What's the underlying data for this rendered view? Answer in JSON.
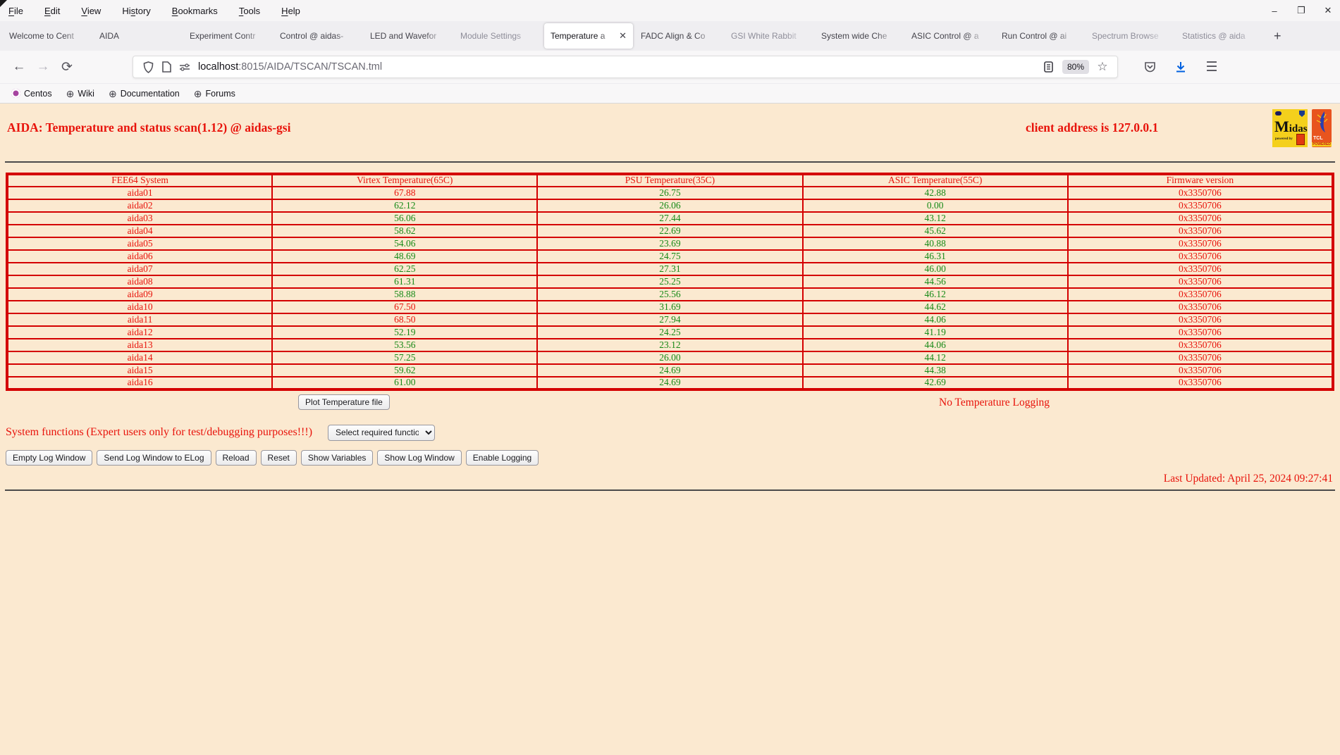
{
  "colors": {
    "page_background": "#fbe9d0",
    "accent_red": "#e8130b",
    "value_green": "#168a16",
    "table_border_red": "#d40000",
    "download_blue": "#0060df"
  },
  "browser": {
    "menu_items": [
      {
        "label": "File",
        "accel": 0
      },
      {
        "label": "Edit",
        "accel": 0
      },
      {
        "label": "View",
        "accel": 0
      },
      {
        "label": "History",
        "accel": 2
      },
      {
        "label": "Bookmarks",
        "accel": 0
      },
      {
        "label": "Tools",
        "accel": 0
      },
      {
        "label": "Help",
        "accel": 0
      }
    ],
    "window_controls": [
      {
        "name": "minimize",
        "glyph": "–"
      },
      {
        "name": "maximize",
        "glyph": "❐"
      },
      {
        "name": "close",
        "glyph": "✕"
      }
    ],
    "tabs": [
      {
        "label": "Welcome to Cent",
        "active": false,
        "dim": false
      },
      {
        "label": "AIDA",
        "active": false,
        "dim": false
      },
      {
        "label": "Experiment Contr",
        "active": false,
        "dim": false
      },
      {
        "label": "Control @ aidas-",
        "active": false,
        "dim": false
      },
      {
        "label": "LED and Wavefor",
        "active": false,
        "dim": false
      },
      {
        "label": "Module Settings",
        "active": false,
        "dim": true
      },
      {
        "label": "Temperature a",
        "active": true,
        "dim": false
      },
      {
        "label": "FADC Align & Co",
        "active": false,
        "dim": false
      },
      {
        "label": "GSI White Rabbit",
        "active": false,
        "dim": true
      },
      {
        "label": "System wide Che",
        "active": false,
        "dim": false
      },
      {
        "label": "ASIC Control @ a",
        "active": false,
        "dim": false
      },
      {
        "label": "Run Control @ ai",
        "active": false,
        "dim": false
      },
      {
        "label": "Spectrum Browse",
        "active": false,
        "dim": true
      },
      {
        "label": "Statistics @ aida",
        "active": false,
        "dim": true
      }
    ],
    "tab_close_glyph": "✕",
    "new_tab_button": "+",
    "url": {
      "host": "localhost",
      "rest": ":8015/AIDA/TSCAN/TSCAN.tml"
    },
    "zoom_level": "80%",
    "bookmarks": [
      {
        "label": "Centos",
        "icon": "centos"
      },
      {
        "label": "Wiki",
        "icon": "globe"
      },
      {
        "label": "Documentation",
        "icon": "globe"
      },
      {
        "label": "Forums",
        "icon": "globe"
      }
    ],
    "globe_glyph": "⊕",
    "hamburger_glyph": "☰",
    "star_glyph": "☆",
    "back_glyph": "←",
    "forward_glyph": "→",
    "reload_glyph": "⟳"
  },
  "page": {
    "title": "AIDA: Temperature and status scan(1.12) @ aidas-gsi",
    "client_address": "client address is 127.0.0.1",
    "logos": {
      "midas_big_letter": "M",
      "midas_rest": "idas",
      "midas_powered_by": "powered by",
      "tcl_text": "TCL",
      "tcl_banner": "POWERED"
    },
    "table": {
      "headers": [
        "FEE64 System",
        "Virtex Temperature(65C)",
        "PSU Temperature(35C)",
        "ASIC Temperature(55C)",
        "Firmware version"
      ],
      "rows": [
        {
          "system": "aida01",
          "virtex": "67.88",
          "virtex_alarm": true,
          "psu": "26.75",
          "asic": "42.88",
          "firmware": "0x3350706"
        },
        {
          "system": "aida02",
          "virtex": "62.12",
          "virtex_alarm": false,
          "psu": "26.06",
          "asic": "0.00",
          "firmware": "0x3350706"
        },
        {
          "system": "aida03",
          "virtex": "56.06",
          "virtex_alarm": false,
          "psu": "27.44",
          "asic": "43.12",
          "firmware": "0x3350706"
        },
        {
          "system": "aida04",
          "virtex": "58.62",
          "virtex_alarm": false,
          "psu": "22.69",
          "asic": "45.62",
          "firmware": "0x3350706"
        },
        {
          "system": "aida05",
          "virtex": "54.06",
          "virtex_alarm": false,
          "psu": "23.69",
          "asic": "40.88",
          "firmware": "0x3350706"
        },
        {
          "system": "aida06",
          "virtex": "48.69",
          "virtex_alarm": false,
          "psu": "24.75",
          "asic": "46.31",
          "firmware": "0x3350706"
        },
        {
          "system": "aida07",
          "virtex": "62.25",
          "virtex_alarm": false,
          "psu": "27.31",
          "asic": "46.00",
          "firmware": "0x3350706"
        },
        {
          "system": "aida08",
          "virtex": "61.31",
          "virtex_alarm": false,
          "psu": "25.25",
          "asic": "44.56",
          "firmware": "0x3350706"
        },
        {
          "system": "aida09",
          "virtex": "58.88",
          "virtex_alarm": false,
          "psu": "25.56",
          "asic": "46.12",
          "firmware": "0x3350706"
        },
        {
          "system": "aida10",
          "virtex": "67.50",
          "virtex_alarm": true,
          "psu": "31.69",
          "asic": "44.62",
          "firmware": "0x3350706"
        },
        {
          "system": "aida11",
          "virtex": "68.50",
          "virtex_alarm": true,
          "psu": "27.94",
          "asic": "44.06",
          "firmware": "0x3350706"
        },
        {
          "system": "aida12",
          "virtex": "52.19",
          "virtex_alarm": false,
          "psu": "24.25",
          "asic": "41.19",
          "firmware": "0x3350706"
        },
        {
          "system": "aida13",
          "virtex": "53.56",
          "virtex_alarm": false,
          "psu": "23.12",
          "asic": "44.06",
          "firmware": "0x3350706"
        },
        {
          "system": "aida14",
          "virtex": "57.25",
          "virtex_alarm": false,
          "psu": "26.00",
          "asic": "44.12",
          "firmware": "0x3350706"
        },
        {
          "system": "aida15",
          "virtex": "59.62",
          "virtex_alarm": false,
          "psu": "24.69",
          "asic": "44.38",
          "firmware": "0x3350706"
        },
        {
          "system": "aida16",
          "virtex": "61.00",
          "virtex_alarm": false,
          "psu": "24.69",
          "asic": "42.69",
          "firmware": "0x3350706"
        }
      ]
    },
    "plot_button": "Plot Temperature file",
    "logging_status": "No Temperature Logging",
    "system_functions_label": "System functions (Expert users only for test/debugging purposes!!!)",
    "function_select_value": "Select required function",
    "log_buttons": [
      "Empty Log Window",
      "Send Log Window to ELog",
      "Reload",
      "Reset",
      "Show Variables",
      "Show Log Window",
      "Enable Logging"
    ],
    "last_updated": "Last Updated: April 25, 2024 09:27:41"
  }
}
